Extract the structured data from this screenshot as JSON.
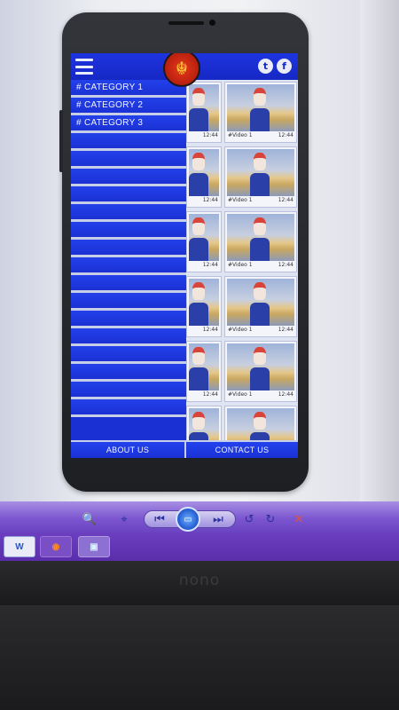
{
  "app": {
    "logo_glyph": "☬",
    "social": {
      "twitter_icon": "twitter-icon",
      "facebook_icon": "facebook-icon"
    },
    "menu": {
      "items": [
        "# CATEGORY 1",
        "# CATEGORY 2",
        "# CATEGORY 3",
        "",
        "",
        "",
        "",
        "",
        "",
        "",
        "",
        "",
        "",
        "",
        "",
        "",
        "",
        "",
        ""
      ]
    },
    "videos": [
      {
        "label": "",
        "duration": "12:44"
      },
      {
        "label": "#Video 1",
        "duration": "12:44"
      },
      {
        "label": "",
        "duration": "12:44"
      },
      {
        "label": "#Video 1",
        "duration": "12:44"
      },
      {
        "label": "",
        "duration": "12:44"
      },
      {
        "label": "#Video 1",
        "duration": "12:44"
      },
      {
        "label": "",
        "duration": "12:44"
      },
      {
        "label": "#Video 1",
        "duration": "12:44"
      },
      {
        "label": "",
        "duration": "12:44"
      },
      {
        "label": "#Video 1",
        "duration": "12:44"
      },
      {
        "label": "",
        "duration": ""
      },
      {
        "label": "",
        "duration": ""
      }
    ],
    "footer": {
      "about": "ABOUT US",
      "contact": "CONTACT US"
    }
  },
  "media_toolbar": {
    "zoom_icon": "🔍",
    "target_icon": "⌖",
    "prev_icon": "⏮",
    "play_icon": "▭",
    "next_icon": "⏭",
    "rotate_left_icon": "↺",
    "rotate_right_icon": "↻",
    "delete_icon": "✕"
  },
  "taskbar": {
    "word": "W",
    "firefox": "◉",
    "explorer": "▣"
  },
  "monitor": {
    "brand": "nono"
  },
  "colors": {
    "accent": "#1b2ec7",
    "menu_divider": "#c7cee8",
    "toolbar": "#7b56cf"
  }
}
